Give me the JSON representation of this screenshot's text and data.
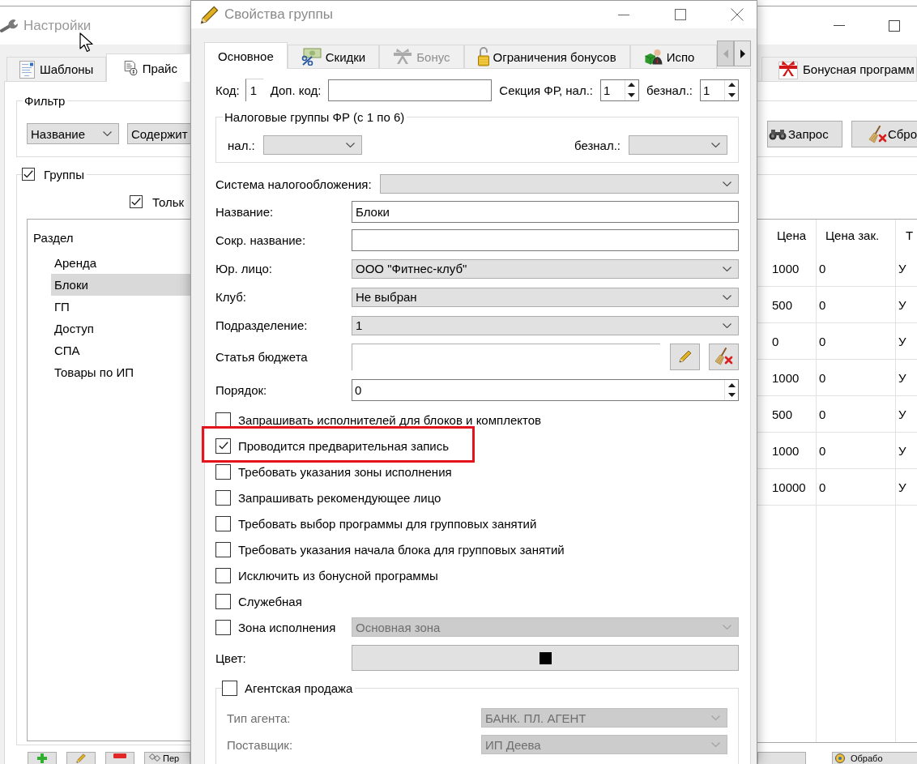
{
  "main_window": {
    "title": "Настройки",
    "tabs": [
      {
        "label": "Шаблоны",
        "selected": false
      },
      {
        "label": "Прайс",
        "selected": true
      },
      {
        "label": "Бонусная программ",
        "selected": false
      }
    ],
    "filter": {
      "title": "Фильтр",
      "field": "Название",
      "condition": "Содержит",
      "buttons": [
        "Запрос",
        "Сбро"
      ]
    },
    "groups": {
      "label": "Группы",
      "checked": true,
      "only_option": {
        "label": "Тольк",
        "checked": true
      },
      "tree": {
        "items": [
          {
            "label": "Раздел",
            "selected": false,
            "children": [
              {
                "label": "Аренда",
                "selected": false
              },
              {
                "label": "Блоки",
                "selected": true
              },
              {
                "label": "ГП",
                "selected": false
              },
              {
                "label": "Доступ",
                "selected": false
              },
              {
                "label": "СПА",
                "selected": false
              },
              {
                "label": "Товары по ИП",
                "selected": false
              }
            ]
          }
        ]
      }
    },
    "table": {
      "columns": [
        "Цена",
        "Цена зак.",
        "Т"
      ],
      "rows": [
        [
          "1000",
          "0",
          "У"
        ],
        [
          "500",
          "0",
          "У"
        ],
        [
          "0",
          "0",
          "У"
        ],
        [
          "1000",
          "0",
          "У"
        ],
        [
          "500",
          "0",
          "У"
        ],
        [
          "1000",
          "0",
          "У"
        ],
        [
          "10000",
          "0",
          "У"
        ]
      ]
    },
    "toolbar": {
      "left_label": "Пер",
      "right_label": "Обрабо"
    }
  },
  "dialog": {
    "title": "Свойства группы",
    "tabs": [
      {
        "label": "Основное",
        "selected": true,
        "disabled": false
      },
      {
        "label": "Скидки",
        "selected": false,
        "disabled": false
      },
      {
        "label": "Бонус",
        "selected": false,
        "disabled": true
      },
      {
        "label": "Ограничения бонусов",
        "selected": false,
        "disabled": false
      },
      {
        "label": "Испо",
        "selected": false,
        "disabled": false
      }
    ],
    "tab_scroll": {
      "left_disabled": true,
      "right_disabled": false
    },
    "code": {
      "label": "Код:",
      "value": "1"
    },
    "extra_code": {
      "label": "Доп. код:"
    },
    "fr_section": {
      "cash": {
        "label": "Секция ФР, нал.:",
        "value": "1"
      },
      "cashless": {
        "label": "безнал.:",
        "value": "1"
      }
    },
    "tax_groups": {
      "title": "Налоговые группы ФР (с 1 по 6)",
      "cash_label": "нал.:",
      "cashless_label": "безнал.:"
    },
    "tax_system": {
      "label": "Система налогообложения:"
    },
    "fields": [
      {
        "kind": "text",
        "label": "Название:",
        "value": "Блоки"
      },
      {
        "kind": "text",
        "label": "Сокр. название:"
      },
      {
        "kind": "combo",
        "label": "Юр. лицо:",
        "value": "ООО \"Фитнес-клуб\""
      },
      {
        "kind": "combo",
        "label": "Клуб:",
        "value": "Не выбран"
      },
      {
        "kind": "combo",
        "label": "Подразделение:",
        "value": "1"
      },
      {
        "kind": "picker",
        "label": "Статья бюджета"
      },
      {
        "kind": "spin",
        "label": "Порядок:",
        "value": "0"
      }
    ],
    "options": [
      {
        "kind": "plain",
        "label": "Запрашивать исполнителей для блоков и комплектов",
        "checked": false,
        "highlighted": false
      },
      {
        "kind": "plain",
        "label": "Проводится предварительная запись",
        "checked": true,
        "highlighted": true
      },
      {
        "kind": "plain",
        "label": "Требовать указания зоны исполнения",
        "checked": false,
        "highlighted": false
      },
      {
        "kind": "plain",
        "label": "Запрашивать рекомендующее лицо",
        "checked": false,
        "highlighted": false
      },
      {
        "kind": "plain",
        "label": "Требовать выбор программы для групповых занятий",
        "checked": false,
        "highlighted": false
      },
      {
        "kind": "plain",
        "label": "Требовать указания начала блока для групповых занятий",
        "checked": false,
        "highlighted": false
      },
      {
        "kind": "plain",
        "label": "Исключить из бонусной программы",
        "checked": false,
        "highlighted": false
      },
      {
        "kind": "plain",
        "label": "Служебная",
        "checked": false,
        "highlighted": false
      },
      {
        "kind": "with_combo",
        "label": "Зона исполнения",
        "checked": false,
        "highlighted": false,
        "combo": {
          "value": "Основная зона",
          "disabled": true
        }
      }
    ],
    "color": {
      "label": "Цвет:",
      "color": "#000000"
    },
    "agent_sale": {
      "label": "Агентская продажа",
      "checked": false,
      "fields": [
        {
          "label": "Тип агента:",
          "value": "БАНК. ПЛ. АГЕНТ",
          "disabled": true
        },
        {
          "label": "Поставщик:",
          "value": "ИП Деева",
          "disabled": true
        }
      ]
    }
  }
}
